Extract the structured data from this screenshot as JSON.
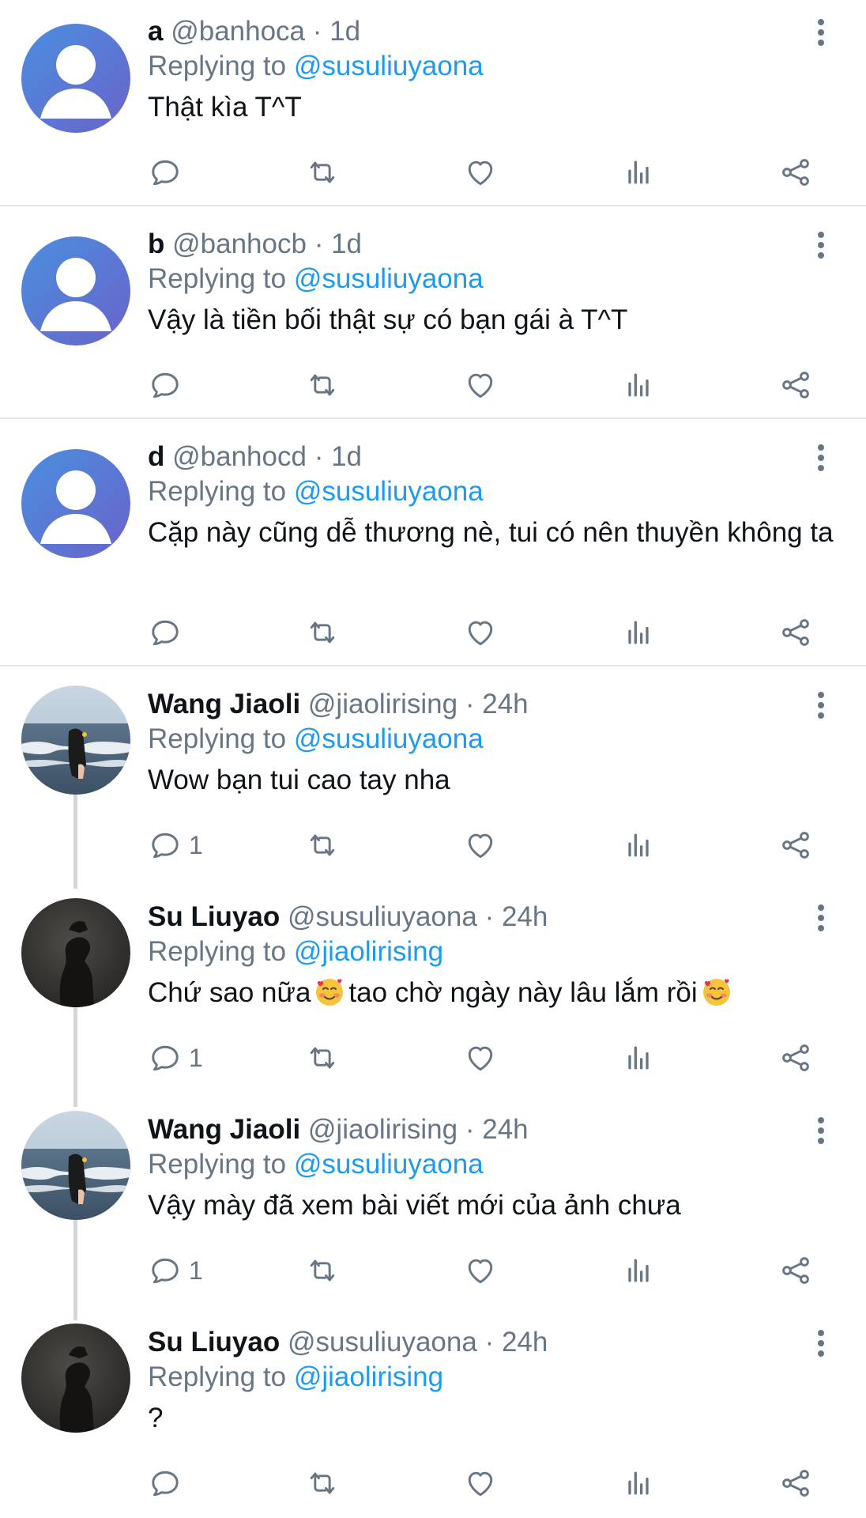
{
  "colors": {
    "link": "#1d9bf0",
    "secondary": "#687684",
    "divider": "#e6e6e6"
  },
  "tweets": [
    {
      "name": "a",
      "handle": "@banhoca",
      "time": "· 1d",
      "replying_label": "Replying to",
      "mention": "@susuliuyaona",
      "text": "Thật kìa T^T",
      "reply_count": "",
      "avatar": "default-avatar-icon"
    },
    {
      "name": "b",
      "handle": "@banhocb",
      "time": "· 1d",
      "replying_label": "Replying to",
      "mention": "@susuliuyaona",
      "text": "Vậy là tiền bối thật sự có bạn gái à T^T",
      "reply_count": "",
      "avatar": "default-avatar-icon"
    },
    {
      "name": "d",
      "handle": "@banhocd",
      "time": "· 1d",
      "replying_label": "Replying to",
      "mention": "@susuliuyaona",
      "text": "Cặp này cũng dễ thương nè, tui có nên thuyền không ta",
      "reply_count": "",
      "avatar": "default-avatar-icon"
    },
    {
      "name": "Wang Jiaoli",
      "handle": "@jiaolirising",
      "time": "· 24h",
      "replying_label": "Replying to",
      "mention": "@susuliuyaona",
      "text": "Wow bạn tui cao tay nha",
      "reply_count": "1",
      "avatar": "beach-photo-avatar"
    },
    {
      "name": "Su Liuyao",
      "handle": "@susuliuyaona",
      "time": "· 24h",
      "replying_label": "Replying to",
      "mention": "@jiaolirising",
      "text_parts": [
        "Chứ sao nữa",
        "tao chờ ngày này lâu lắm rồi"
      ],
      "emoji": "smiling-face-with-hearts-emoji",
      "reply_count": "1",
      "avatar": "dark-silhouette-avatar"
    },
    {
      "name": "Wang Jiaoli",
      "handle": "@jiaolirising",
      "time": "· 24h",
      "replying_label": "Replying to",
      "mention": "@susuliuyaona",
      "text": "Vậy mày đã xem bài viết mới của ảnh chưa",
      "reply_count": "1",
      "avatar": "beach-photo-avatar"
    },
    {
      "name": "Su Liuyao",
      "handle": "@susuliuyaona",
      "time": "· 24h",
      "replying_label": "Replying to",
      "mention": "@jiaolirising",
      "text": "?",
      "reply_count": "",
      "avatar": "dark-silhouette-avatar"
    }
  ],
  "action_icons": [
    "reply-icon",
    "retweet-icon",
    "like-icon",
    "analytics-icon",
    "share-icon"
  ]
}
